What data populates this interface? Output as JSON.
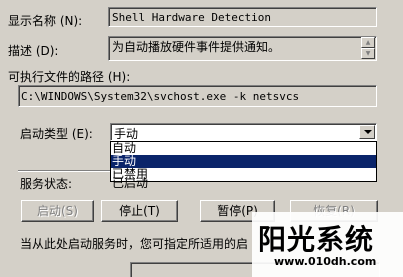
{
  "form": {
    "display_name_label": "显示名称 (N):",
    "display_name_value": "Shell Hardware Detection",
    "description_label": "描述 (D):",
    "description_value": "为自动播放硬件事件提供通知。",
    "exe_path_label": "可执行文件的路径 (H):",
    "exe_path_value": "C:\\WINDOWS\\System32\\svchost.exe -k netsvcs",
    "startup_type_label": "启动类型 (E):",
    "startup_type_value": "手动",
    "startup_options": [
      "自动",
      "手动",
      "已禁用"
    ],
    "startup_selected_index": 1,
    "service_status_label": "服务状态:",
    "service_status_value": "已启动",
    "hint_text": "当从此处启动服务时，您可指定所适用的启"
  },
  "buttons": {
    "start": "启动(S)",
    "stop": "停止(T)",
    "pause": "暂停(P)",
    "resume": "恢复(R)"
  },
  "watermark": {
    "title": "阳光系统",
    "url": "www.010dh.com"
  }
}
